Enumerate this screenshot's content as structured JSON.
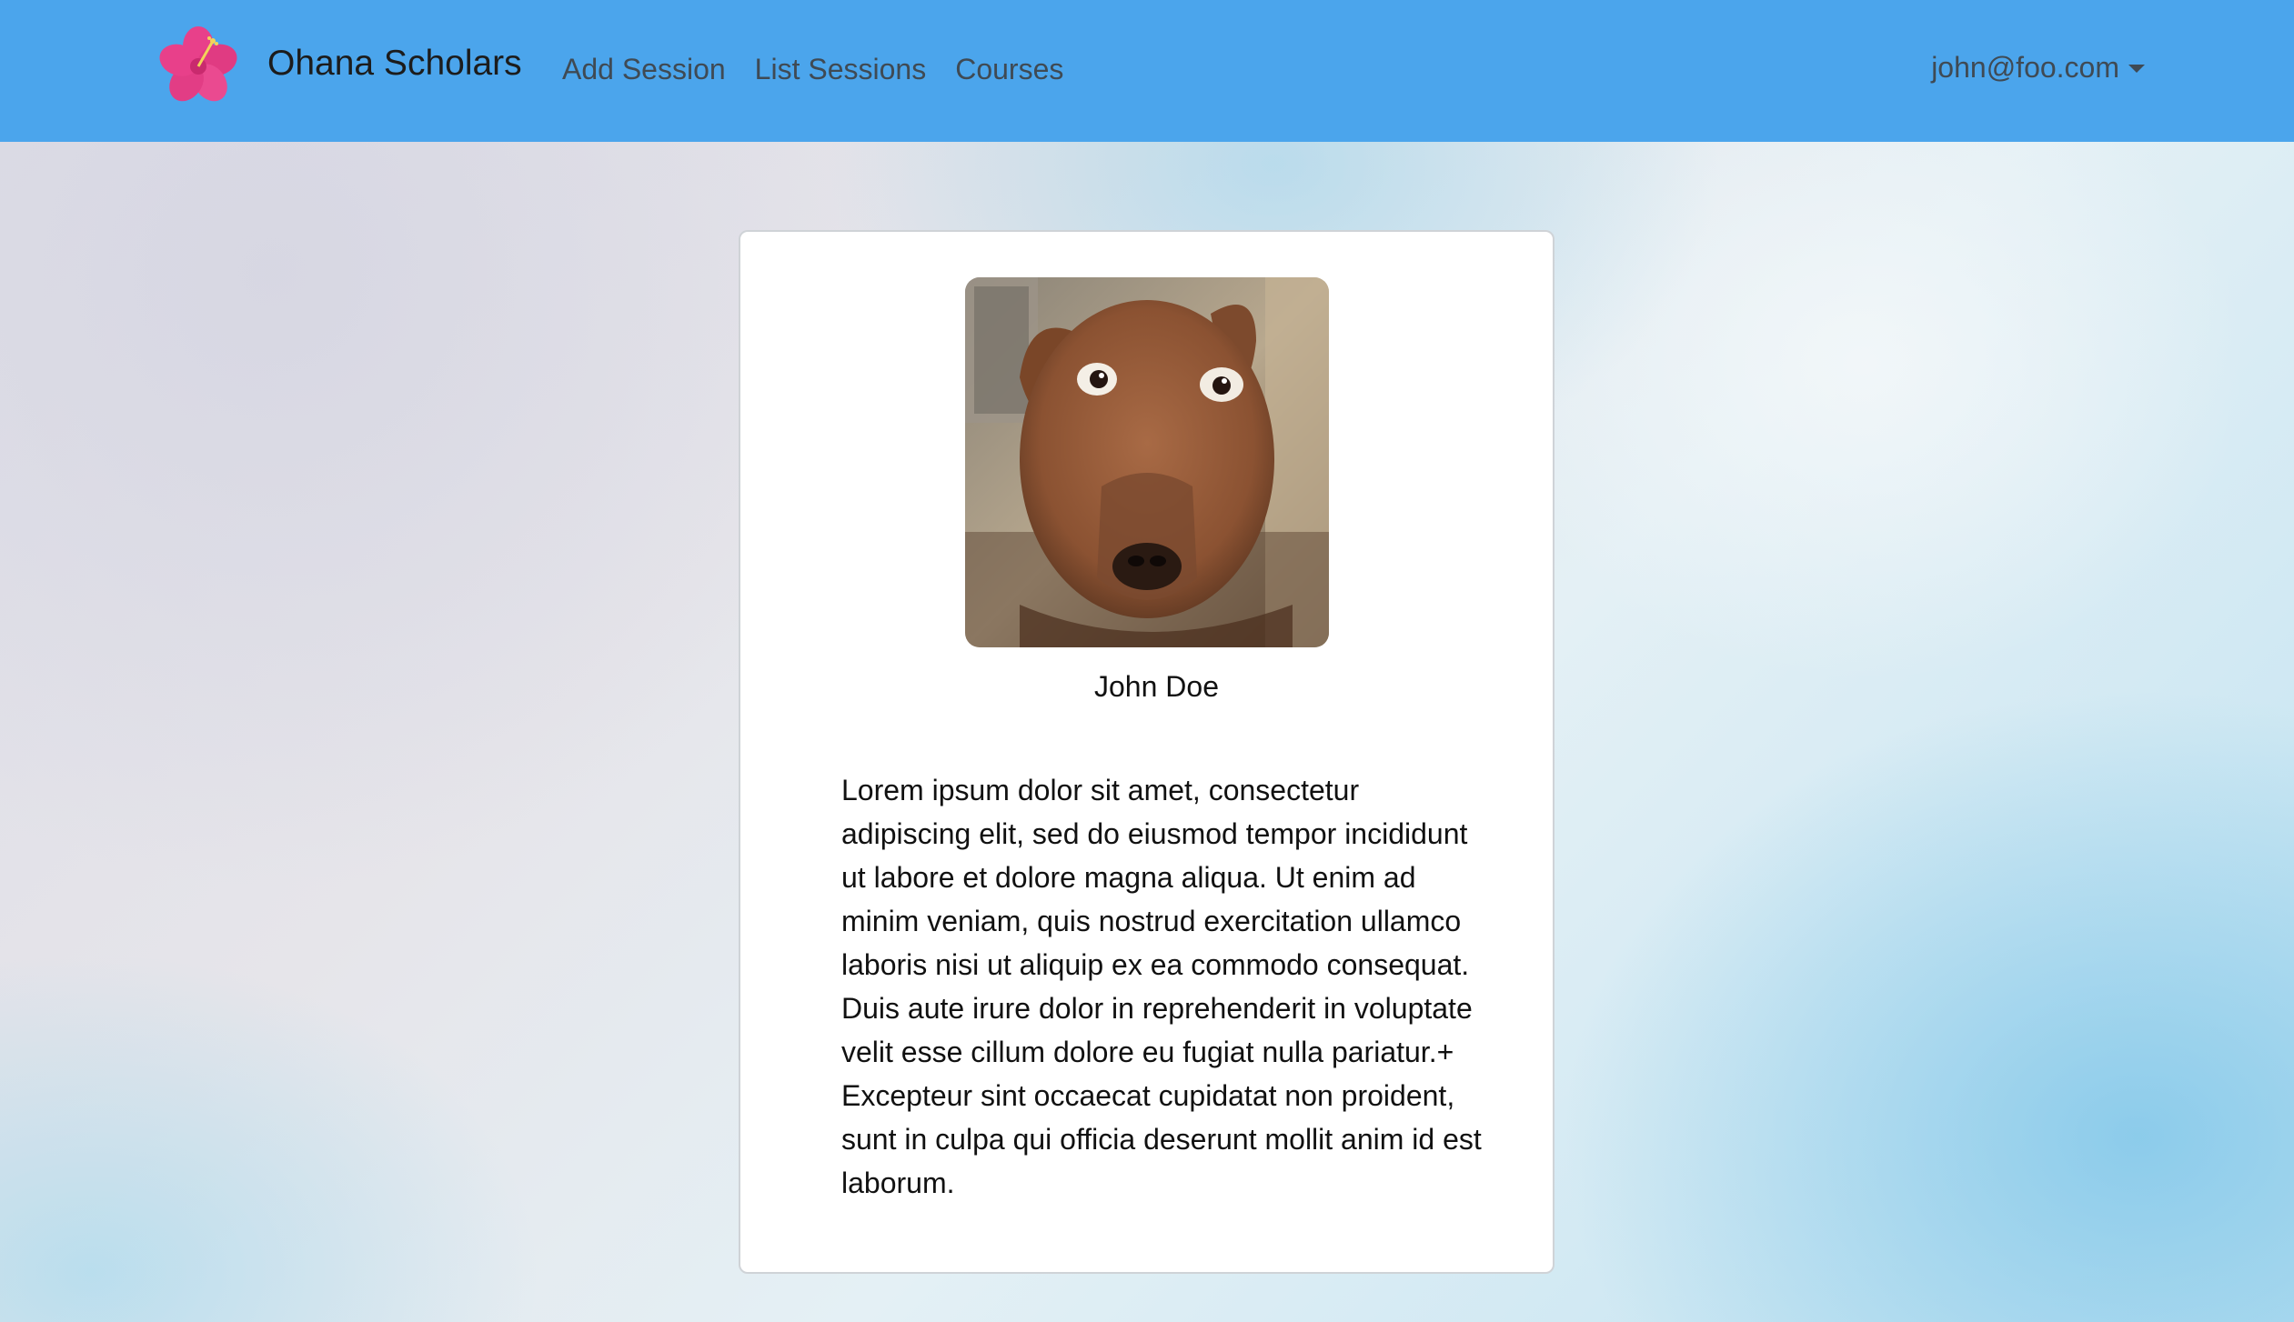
{
  "navbar": {
    "brand": "Ohana Scholars",
    "links": [
      {
        "label": "Add Session"
      },
      {
        "label": "List Sessions"
      },
      {
        "label": "Courses"
      }
    ],
    "user": {
      "email": "john@foo.com"
    }
  },
  "profile": {
    "name": "John Doe",
    "bio": "Lorem ipsum dolor sit amet, consectetur adipiscing elit, sed do eiusmod tempor incididunt ut labore et dolore magna aliqua. Ut enim ad minim veniam, quis nostrud exercitation ullamco laboris nisi ut aliquip ex ea commodo consequat. Duis aute irure dolor in reprehenderit in voluptate velit esse cillum dolore eu fugiat nulla pariatur.+ Excepteur sint occaecat cupidatat non proident, sunt in culpa qui officia deserunt mollit anim id est laborum."
  },
  "colors": {
    "navbar": "#4ba5ec",
    "hibiscus": "#e8408a"
  },
  "icons": {
    "logo": "hibiscus-flower-icon",
    "dropdown": "caret-down-icon"
  }
}
